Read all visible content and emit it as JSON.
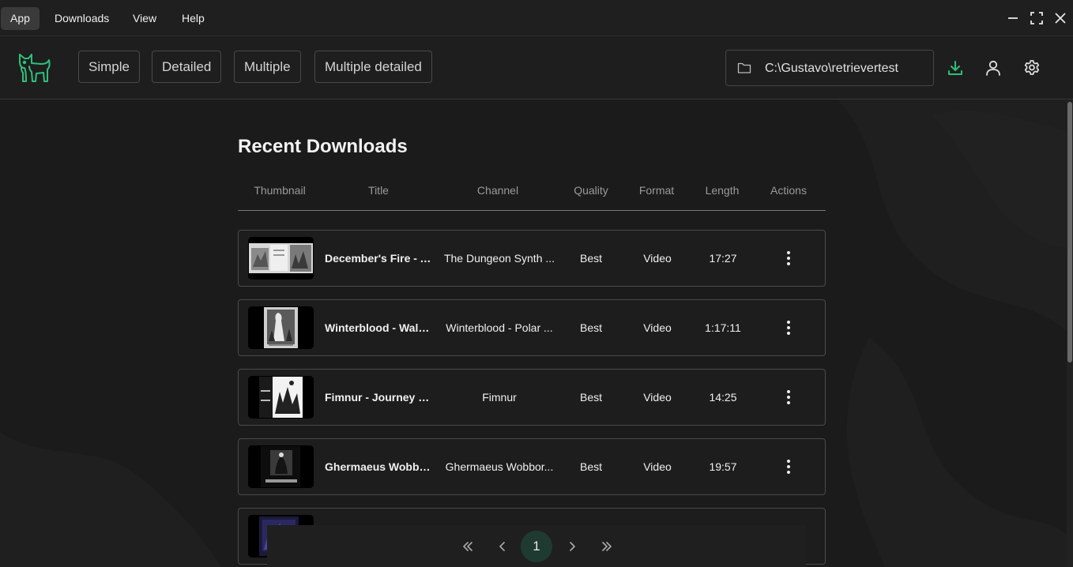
{
  "menubar": {
    "items": [
      {
        "label": "App",
        "active": true
      },
      {
        "label": "Downloads",
        "active": false
      },
      {
        "label": "View",
        "active": false
      },
      {
        "label": "Help",
        "active": false
      }
    ],
    "window_controls": [
      "minimize-icon",
      "maximize-icon",
      "close-icon"
    ]
  },
  "toolbar": {
    "logo_icon": "dog-logo-icon",
    "modes": [
      "Simple",
      "Detailed",
      "Multiple",
      "Multiple detailed"
    ],
    "path": "C:\\Gustavo\\retrievertest",
    "icons": [
      "download-icon",
      "user-icon",
      "gear-icon"
    ]
  },
  "colors": {
    "accent": "#2fbf7a",
    "background": "#1b1b1b",
    "pager_active": "#1f3b31"
  },
  "main": {
    "title": "Recent Downloads",
    "columns": [
      "Thumbnail",
      "Title",
      "Channel",
      "Quality",
      "Format",
      "Length",
      "Actions"
    ],
    "rows": [
      {
        "title": "December's Fire - A...",
        "channel": "The Dungeon Synth ...",
        "quality": "Best",
        "format": "Video",
        "length": "17:27"
      },
      {
        "title": "Winterblood - Walde...",
        "channel": "Winterblood - Polar ...",
        "quality": "Best",
        "format": "Video",
        "length": "1:17:11"
      },
      {
        "title": "Fimnur - Journey Ho...",
        "channel": "Fimnur",
        "quality": "Best",
        "format": "Video",
        "length": "14:25"
      },
      {
        "title": "Ghermaeus Wobbor...",
        "channel": "Ghermaeus Wobbor...",
        "quality": "Best",
        "format": "Video",
        "length": "19:57"
      },
      {
        "title": "",
        "channel": "",
        "quality": "",
        "format": "",
        "length": ""
      }
    ]
  },
  "pagination": {
    "current_page": "1",
    "controls": [
      "first-page-icon",
      "prev-page-icon",
      "next-page-icon",
      "last-page-icon"
    ]
  }
}
